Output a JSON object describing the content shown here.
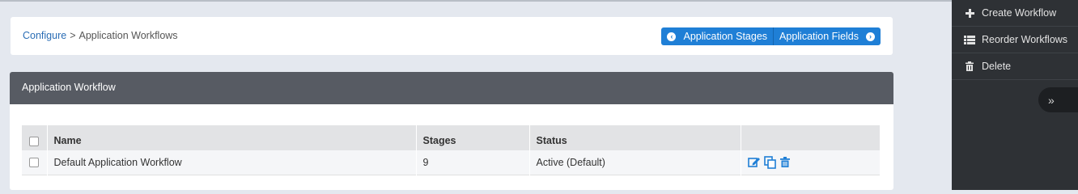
{
  "breadcrumb": {
    "link": "Configure",
    "separator": ">",
    "current": "Application Workflows"
  },
  "header_buttons": {
    "stages_label": "Application Stages",
    "fields_label": "Application Fields"
  },
  "panel": {
    "title": "Application Workflow"
  },
  "table": {
    "columns": [
      "Name",
      "Stages",
      "Status"
    ],
    "rows": [
      {
        "name": "Default Application Workflow",
        "stages": "9",
        "status": "Active (Default)"
      }
    ]
  },
  "sidebar": {
    "items": [
      {
        "label": "Create Workflow",
        "icon": "plus-icon"
      },
      {
        "label": "Reorder Workflows",
        "icon": "list-icon"
      },
      {
        "label": "Delete",
        "icon": "trash-icon"
      }
    ],
    "collapse_icon": "double-chevron-right-icon"
  },
  "colors": {
    "accent": "#1f7fd6",
    "panel_header": "#575b63",
    "sidebar_bg": "#2e3135",
    "page_bg": "#e4e8ef"
  }
}
